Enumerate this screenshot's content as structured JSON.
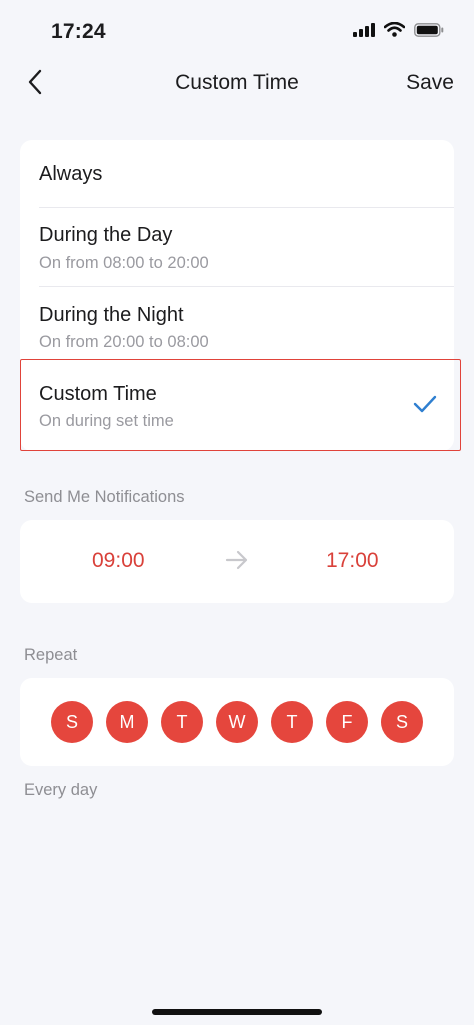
{
  "status_bar": {
    "time": "17:24"
  },
  "header": {
    "title": "Custom Time",
    "save_label": "Save"
  },
  "options": [
    {
      "title": "Always"
    },
    {
      "title": "During the Day",
      "subtitle": "On from 08:00 to 20:00"
    },
    {
      "title": "During the Night",
      "subtitle": "On from 20:00 to 08:00"
    },
    {
      "title": "Custom Time",
      "subtitle": "On during set time",
      "selected": true
    }
  ],
  "notifications": {
    "label": "Send Me Notifications",
    "start_time": "09:00",
    "end_time": "17:00"
  },
  "repeat": {
    "label": "Repeat",
    "days": [
      "S",
      "M",
      "T",
      "W",
      "T",
      "F",
      "S"
    ],
    "summary": "Every day"
  },
  "colors": {
    "accent_red": "#e5463d",
    "time_text": "#d9413a",
    "check_blue": "#2f7fd0",
    "highlight_border": "#e0433a"
  }
}
